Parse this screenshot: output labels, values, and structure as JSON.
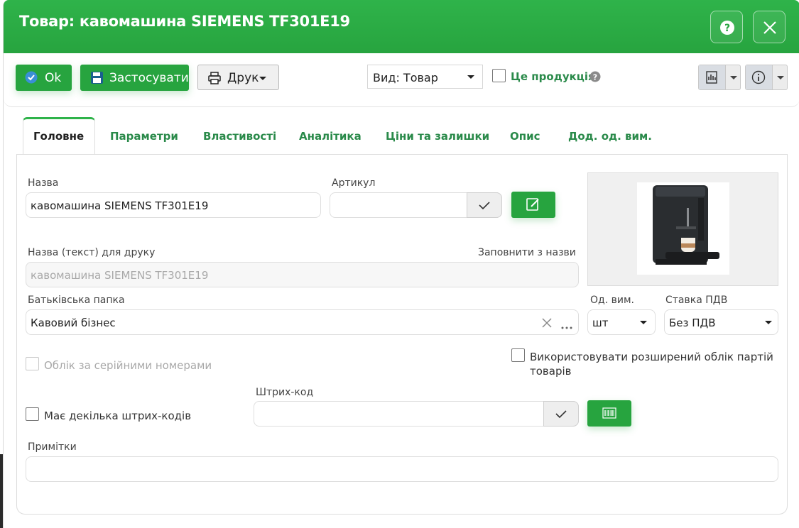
{
  "window": {
    "title": "Товар: кавомашина SIEMENS TF301E19",
    "help_icon": "question-circle-icon",
    "close_icon": "close-icon"
  },
  "toolbar": {
    "ok_label": "Ok",
    "apply_label": "Застосувати",
    "print_label": "Друк",
    "view_select": "Вид: Товар",
    "is_product_label": "Це продукція",
    "is_product_checked": false
  },
  "tabs": [
    {
      "label": "Головне",
      "active": true
    },
    {
      "label": "Параметри"
    },
    {
      "label": "Властивості"
    },
    {
      "label": "Аналітика"
    },
    {
      "label": "Ціни та залишки"
    },
    {
      "label": "Опис"
    },
    {
      "label": "Дод. од. вим."
    }
  ],
  "form": {
    "name_label": "Назва",
    "name_value": "кавомашина SIEMENS TF301E19",
    "sku_label": "Артикул",
    "sku_value": "",
    "print_name_label": "Назва (текст) для друку",
    "fill_from_name": "Заповнити з назви",
    "print_name_value": "кавомашина SIEMENS TF301E19",
    "parent_folder_label": "Батьківська папка",
    "parent_folder_value": "Кавовий бізнес",
    "unit_label": "Од. вим.",
    "unit_value": "шт",
    "vat_label": "Ставка ПДВ",
    "vat_value": "Без ПДВ",
    "serial_label": "Облік за серійними номерами",
    "batch_label_line1": "Використовувати розширений облік партій",
    "batch_label_line2": "товарів",
    "multi_barcode_label": "Має декілька штрих-кодів",
    "barcode_label": "Штрих-код",
    "barcode_value": "",
    "notes_label": "Примітки",
    "notes_value": ""
  },
  "colors": {
    "brand": "#27a43f",
    "tab_text": "#2a8a4a"
  }
}
